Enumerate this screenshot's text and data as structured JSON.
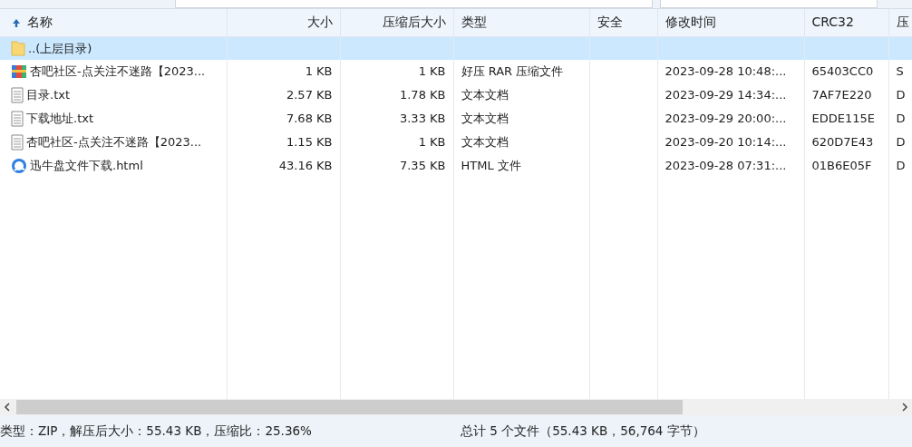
{
  "table": {
    "columns": [
      {
        "label": "名称",
        "sorted": true
      },
      {
        "label": "大小",
        "sorted": false
      },
      {
        "label": "压缩后大小",
        "sorted": false
      },
      {
        "label": "类型",
        "sorted": false
      },
      {
        "label": "安全",
        "sorted": false
      },
      {
        "label": "修改时间",
        "sorted": false
      },
      {
        "label": "CRC32",
        "sorted": false
      },
      {
        "label": "压",
        "sorted": false
      }
    ],
    "rows": [
      {
        "kind": "folder",
        "selected": true,
        "cells": [
          "..(上层目录)",
          "",
          "",
          "",
          "",
          "",
          "",
          ""
        ]
      },
      {
        "kind": "archive",
        "selected": false,
        "cells": [
          "杏吧社区-点关注不迷路【2023...",
          "1 KB",
          "1 KB",
          "好压 RAR 压缩文件",
          "",
          "2023-09-28 10:48:...",
          "65403CC0",
          "S"
        ]
      },
      {
        "kind": "text",
        "selected": false,
        "cells": [
          "目录.txt",
          "2.57 KB",
          "1.78 KB",
          "文本文档",
          "",
          "2023-09-29 14:34:...",
          "7AF7E220",
          "D"
        ]
      },
      {
        "kind": "text",
        "selected": false,
        "cells": [
          "下载地址.txt",
          "7.68 KB",
          "3.33 KB",
          "文本文档",
          "",
          "2023-09-29 20:00:...",
          "EDDE115E",
          "D"
        ]
      },
      {
        "kind": "text",
        "selected": false,
        "cells": [
          "杏吧社区-点关注不迷路【2023...",
          "1.15 KB",
          "1 KB",
          "文本文档",
          "",
          "2023-09-20 10:14:...",
          "620D7E43",
          "D"
        ]
      },
      {
        "kind": "html",
        "selected": false,
        "cells": [
          "迅牛盘文件下载.html",
          "43.16 KB",
          "7.35 KB",
          "HTML 文件",
          "",
          "2023-09-28 07:31:...",
          "01B6E05F",
          "D"
        ]
      }
    ]
  },
  "status_bar": {
    "left": "类型：ZIP，解压后大小：55.43 KB，压缩比：25.36%",
    "right": "总计 5 个文件（55.43 KB，56,764 字节）"
  }
}
